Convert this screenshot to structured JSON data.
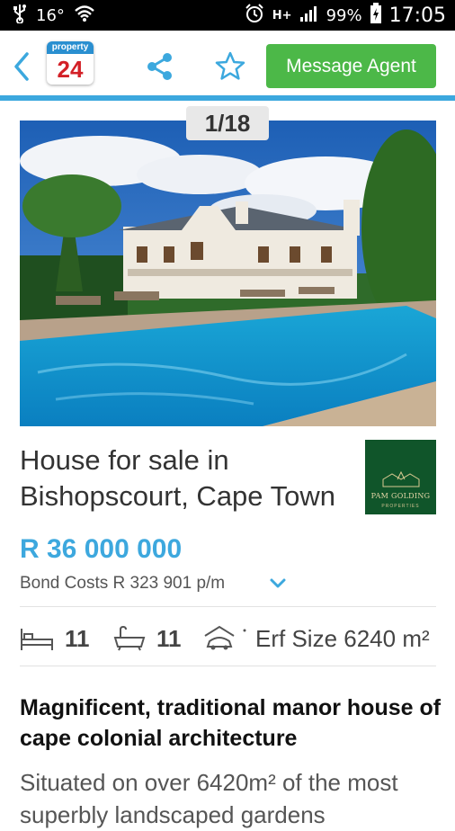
{
  "status_bar": {
    "temperature": "16°",
    "battery": "99%",
    "time": "17:05",
    "network": "H+"
  },
  "header": {
    "logo_top": "property",
    "logo_number": "24",
    "message_button": "Message Agent"
  },
  "gallery": {
    "counter": "1/18"
  },
  "listing": {
    "title": "House for sale in Bishopscourt, Cape Town",
    "agency_name": "PAM GOLDING",
    "agency_sub": "PROPERTIES",
    "price": "R 36 000 000",
    "bond_costs": "Bond Costs R 323 901 p/m",
    "bedrooms": "11",
    "bathrooms": "11",
    "erf_size": "Erf Size 6240 m²",
    "headline": "Magnificent, traditional manor house of cape colonial architecture",
    "description": "Situated on over 6420m² of the most superbly landscaped gardens"
  },
  "colors": {
    "accent_blue": "#3ca8de",
    "button_green": "#4cb848",
    "price_blue": "#3da8de",
    "icon_grey": "#555555"
  },
  "icons": {
    "back": "chevron-left-icon",
    "share": "share-icon",
    "favorite": "star-icon",
    "bed": "bed-icon",
    "bath": "bathtub-icon",
    "garage": "garage-icon",
    "expand": "chevron-down-icon"
  }
}
